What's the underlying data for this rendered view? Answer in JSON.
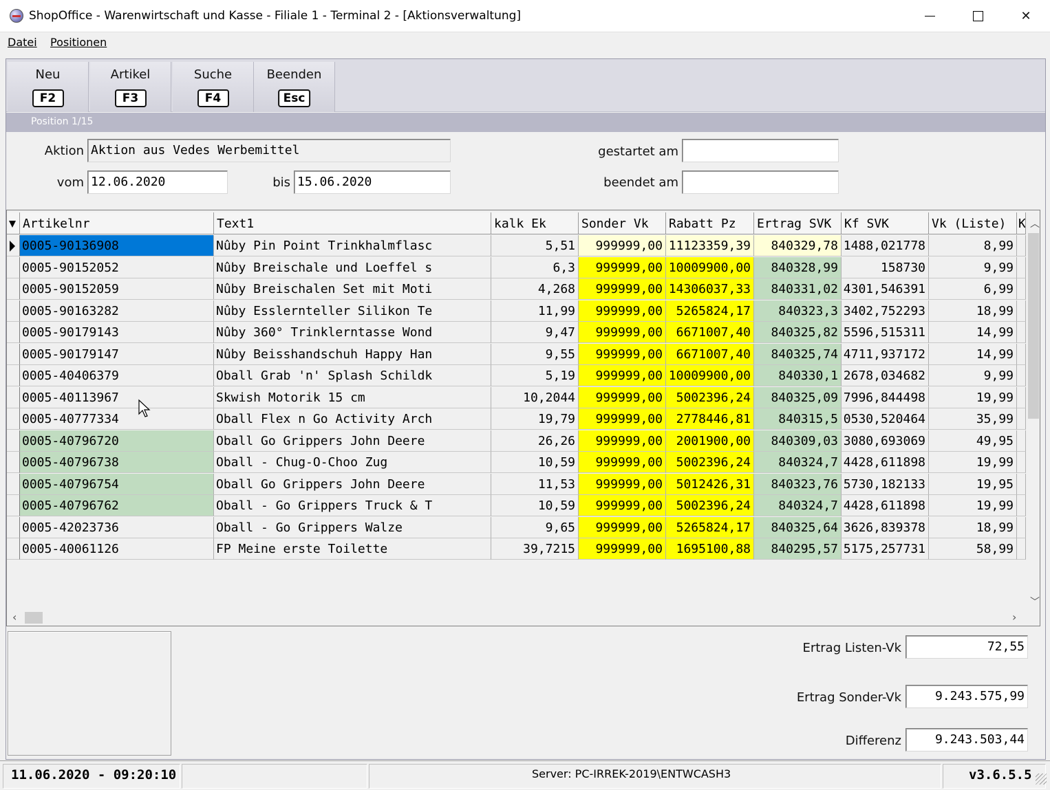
{
  "window": {
    "title": "ShopOffice - Warenwirtschaft und Kasse - Filiale 1 - Terminal 2 - [Aktionsverwaltung]",
    "minimize_icon": "minimize-icon",
    "maximize_icon": "maximize-icon",
    "close_icon": "close-icon",
    "close_glyph": "✕"
  },
  "menu": {
    "datei": "Datei",
    "positionen": "Positionen"
  },
  "toolbar": {
    "neu": {
      "label": "Neu",
      "key": "F2"
    },
    "artikel": {
      "label": "Artikel",
      "key": "F3"
    },
    "suche": {
      "label": "Suche",
      "key": "F4"
    },
    "beenden": {
      "label": "Beenden",
      "key": "Esc"
    }
  },
  "position_text": "Position 1/15",
  "form": {
    "aktion_label": "Aktion",
    "aktion_value": "Aktion aus Vedes Werbemittel",
    "vom_label": "vom",
    "vom_value": "12.06.2020",
    "bis_label": "bis",
    "bis_value": "15.06.2020",
    "gestartet_label": "gestartet am",
    "gestartet_value": "",
    "beendet_label": "beendet am",
    "beendet_value": ""
  },
  "table": {
    "columns": [
      "Artikelnr",
      "Text1",
      "kalk Ek",
      "Sonder Vk",
      "Rabatt Pz",
      "Ertrag SVK",
      "Kf SVK",
      "Vk (Liste)",
      "K"
    ],
    "rows": [
      {
        "artikelnr": "0005-90136908",
        "text1": "Nûby Pin Point Trinkhalmflasc",
        "kalk_ek": "5,51",
        "sonder_vk": "999999,00",
        "rabatt_pz": "11123359,39",
        "ertrag_svk": "840329,78",
        "kf_svk": "1488,021778",
        "vk_liste": "8,99",
        "selected": true,
        "green_artnr": false
      },
      {
        "artikelnr": "0005-90152052",
        "text1": "Nûby Breischale und Loeffel s",
        "kalk_ek": "6,3",
        "sonder_vk": "999999,00",
        "rabatt_pz": "10009900,00",
        "ertrag_svk": "840328,99",
        "kf_svk": "158730",
        "vk_liste": "9,99",
        "selected": false,
        "green_artnr": false
      },
      {
        "artikelnr": "0005-90152059",
        "text1": "Nûby Breischalen Set mit Moti",
        "kalk_ek": "4,268",
        "sonder_vk": "999999,00",
        "rabatt_pz": "14306037,33",
        "ertrag_svk": "840331,02",
        "kf_svk": "4301,546391",
        "vk_liste": "6,99",
        "selected": false,
        "green_artnr": false
      },
      {
        "artikelnr": "0005-90163282",
        "text1": "Nûby Esslernteller Silikon Te",
        "kalk_ek": "11,99",
        "sonder_vk": "999999,00",
        "rabatt_pz": "5265824,17",
        "ertrag_svk": "840323,3",
        "kf_svk": "3402,752293",
        "vk_liste": "18,99",
        "selected": false,
        "green_artnr": false
      },
      {
        "artikelnr": "0005-90179143",
        "text1": "Nûby 360° Trinklerntasse Wond",
        "kalk_ek": "9,47",
        "sonder_vk": "999999,00",
        "rabatt_pz": "6671007,40",
        "ertrag_svk": "840325,82",
        "kf_svk": "5596,515311",
        "vk_liste": "14,99",
        "selected": false,
        "green_artnr": false
      },
      {
        "artikelnr": "0005-90179147",
        "text1": "Nûby Beisshandschuh Happy Han",
        "kalk_ek": "9,55",
        "sonder_vk": "999999,00",
        "rabatt_pz": "6671007,40",
        "ertrag_svk": "840325,74",
        "kf_svk": "4711,937172",
        "vk_liste": "14,99",
        "selected": false,
        "green_artnr": false
      },
      {
        "artikelnr": "0005-40406379",
        "text1": "Oball Grab 'n' Splash Schildk",
        "kalk_ek": "5,19",
        "sonder_vk": "999999,00",
        "rabatt_pz": "10009900,00",
        "ertrag_svk": "840330,1",
        "kf_svk": "2678,034682",
        "vk_liste": "9,99",
        "selected": false,
        "green_artnr": false
      },
      {
        "artikelnr": "0005-40113967",
        "text1": "Skwish Motorik 15 cm",
        "kalk_ek": "10,2044",
        "sonder_vk": "999999,00",
        "rabatt_pz": "5002396,24",
        "ertrag_svk": "840325,09",
        "kf_svk": "7996,844498",
        "vk_liste": "19,99",
        "selected": false,
        "green_artnr": false
      },
      {
        "artikelnr": "0005-40777334",
        "text1": "Oball Flex n Go Activity Arch",
        "kalk_ek": "19,79",
        "sonder_vk": "999999,00",
        "rabatt_pz": "2778446,81",
        "ertrag_svk": "840315,5",
        "kf_svk": "0530,520464",
        "vk_liste": "35,99",
        "selected": false,
        "green_artnr": false
      },
      {
        "artikelnr": "0005-40796720",
        "text1": "Oball Go Grippers John Deere",
        "kalk_ek": "26,26",
        "sonder_vk": "999999,00",
        "rabatt_pz": "2001900,00",
        "ertrag_svk": "840309,03",
        "kf_svk": "3080,693069",
        "vk_liste": "49,95",
        "selected": false,
        "green_artnr": true
      },
      {
        "artikelnr": "0005-40796738",
        "text1": "Oball - Chug-O-Choo Zug",
        "kalk_ek": "10,59",
        "sonder_vk": "999999,00",
        "rabatt_pz": "5002396,24",
        "ertrag_svk": "840324,7",
        "kf_svk": "4428,611898",
        "vk_liste": "19,99",
        "selected": false,
        "green_artnr": true
      },
      {
        "artikelnr": "0005-40796754",
        "text1": "Oball Go Grippers John Deere",
        "kalk_ek": "11,53",
        "sonder_vk": "999999,00",
        "rabatt_pz": "5012426,31",
        "ertrag_svk": "840323,76",
        "kf_svk": "5730,182133",
        "vk_liste": "19,95",
        "selected": false,
        "green_artnr": true
      },
      {
        "artikelnr": "0005-40796762",
        "text1": "Oball - Go Grippers Truck & T",
        "kalk_ek": "10,59",
        "sonder_vk": "999999,00",
        "rabatt_pz": "5002396,24",
        "ertrag_svk": "840324,7",
        "kf_svk": "4428,611898",
        "vk_liste": "19,99",
        "selected": false,
        "green_artnr": true
      },
      {
        "artikelnr": "0005-42023736",
        "text1": "Oball - Go Grippers Walze",
        "kalk_ek": "9,65",
        "sonder_vk": "999999,00",
        "rabatt_pz": "5265824,17",
        "ertrag_svk": "840325,64",
        "kf_svk": "3626,839378",
        "vk_liste": "18,99",
        "selected": false,
        "green_artnr": false
      },
      {
        "artikelnr": "0005-40061126",
        "text1": "FP Meine erste Toilette",
        "kalk_ek": "39,7215",
        "sonder_vk": "999999,00",
        "rabatt_pz": "1695100,88",
        "ertrag_svk": "840295,57",
        "kf_svk": "5175,257731",
        "vk_liste": "58,99",
        "selected": false,
        "green_artnr": false
      }
    ]
  },
  "colors": {
    "selected_blue": "#0078d7",
    "yellow": "#ffff00",
    "pale_yellow": "#ffffd8",
    "green": "#c0dcc0"
  },
  "summary": {
    "ertrag_listen_label": "Ertrag Listen-Vk",
    "ertrag_listen_value": "72,55",
    "ertrag_sonder_label": "Ertrag Sonder-Vk",
    "ertrag_sonder_value": "9.243.575,99",
    "differenz_label": "Differenz",
    "differenz_value": "9.243.503,44"
  },
  "status": {
    "datetime": "11.06.2020 - 09:20:10",
    "server": "Server: PC-IRREK-2019\\ENTWCASH3",
    "version": "v3.6.5.5"
  }
}
